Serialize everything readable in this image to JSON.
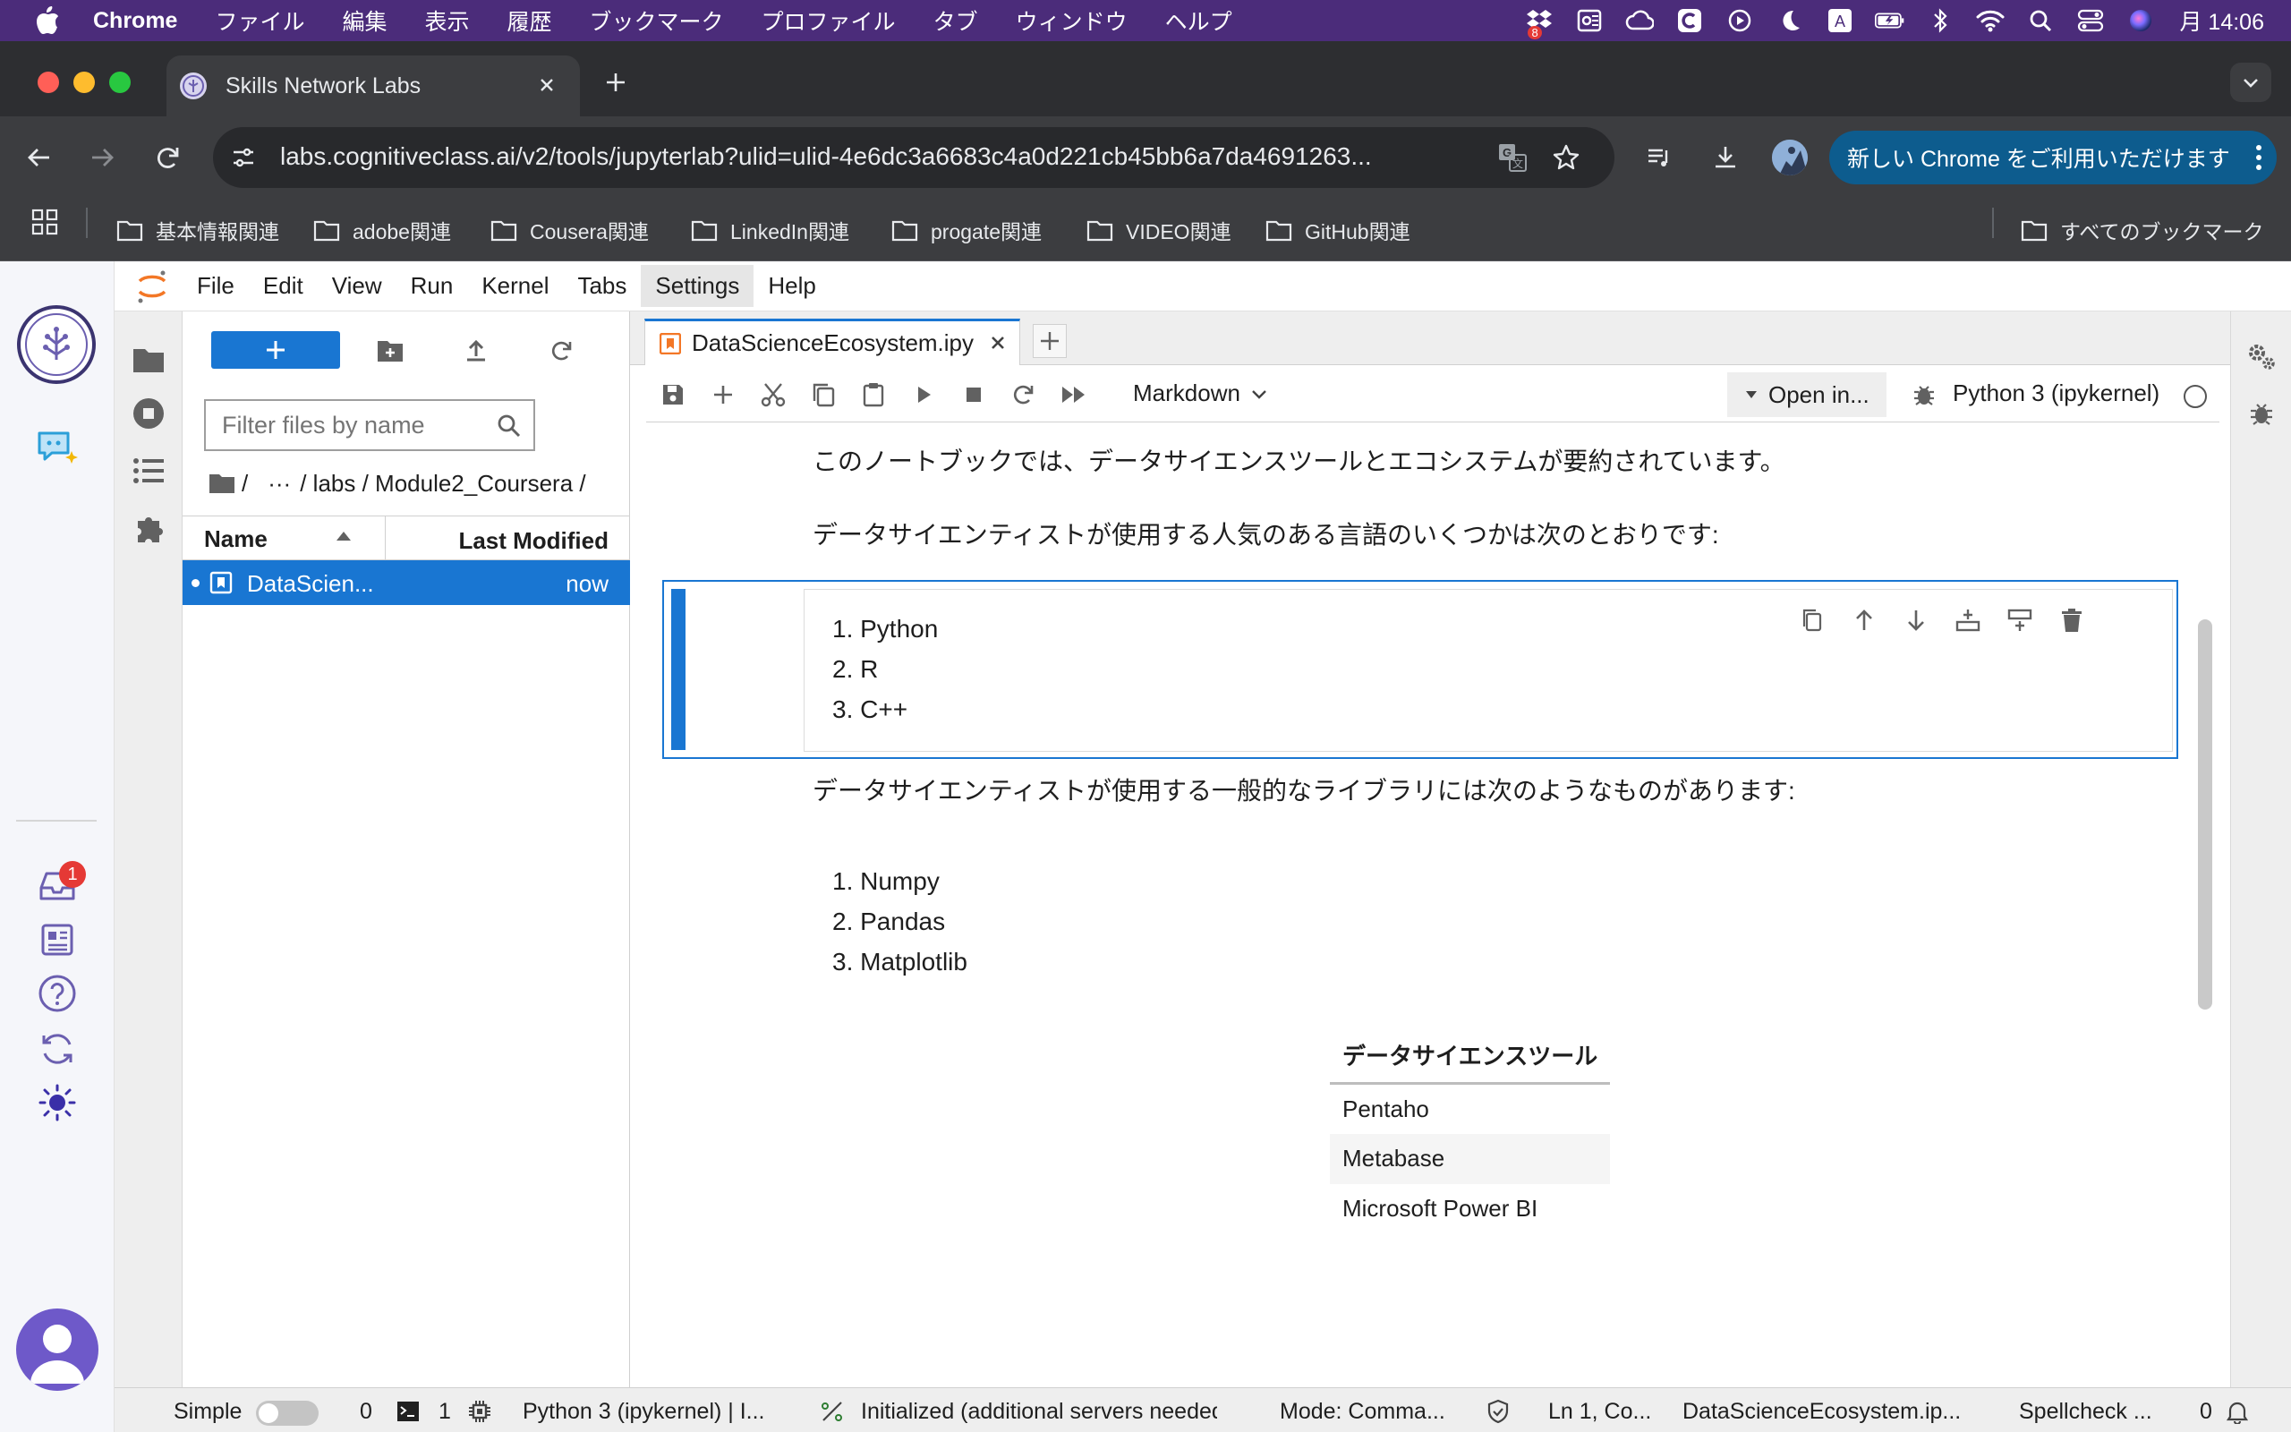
{
  "mac_menubar": {
    "app_name": "Chrome",
    "items": [
      "ファイル",
      "編集",
      "表示",
      "履歴",
      "ブックマーク",
      "プロファイル",
      "タブ",
      "ウィンドウ",
      "ヘルプ"
    ],
    "dropbox_badge": "8",
    "clock": "月 14:06"
  },
  "browser": {
    "tab_title": "Skills Network Labs",
    "url": "labs.cognitiveclass.ai/v2/tools/jupyterlab?ulid=ulid-4e6dc3a6683c4a0d221cb45bb6a7da4691263...",
    "update_button": "新しい Chrome をご利用いただけます",
    "bookmarks": [
      "基本情報関連",
      "adobe関連",
      "Cousera関連",
      "LinkedIn関連",
      "progate関連",
      "VIDEO関連",
      "GitHub関連"
    ],
    "all_bookmarks": "すべてのブックマーク"
  },
  "sn_rail": {
    "inbox_badge": "1"
  },
  "jupyter": {
    "menu": [
      "File",
      "Edit",
      "View",
      "Run",
      "Kernel",
      "Tabs",
      "Settings",
      "Help"
    ],
    "filebrowser": {
      "filter_placeholder": "Filter files by name",
      "breadcrumb": [
        "/",
        "···",
        "/ labs / Module2_Coursera /"
      ],
      "col_name": "Name",
      "col_modified": "Last Modified",
      "files": [
        {
          "name": "DataScien...",
          "modified": "now"
        }
      ]
    },
    "notebook": {
      "tab_title": "DataScienceEcosystem.ipy",
      "cell_type": "Markdown",
      "open_in": "Open in...",
      "kernel": "Python 3 (ipykernel)",
      "intro_text": "このノートブックでは、データサイエンスツールとエコシステムが要約されています。",
      "languages_heading": "データサイエンティストが使用する人気のある言語のいくつかは次のとおりです:",
      "languages": [
        "1. Python",
        "2. R",
        "3. C++"
      ],
      "libraries_heading": "データサイエンティストが使用する一般的なライブラリには次のようなものがあります:",
      "libraries": [
        "1. Numpy",
        "2. Pandas",
        "3. Matplotlib"
      ],
      "table_header": "データサイエンスツール",
      "table_rows": [
        "Pentaho",
        "Metabase",
        "Microsoft Power BI"
      ]
    },
    "statusbar": {
      "simple": "Simple",
      "terminals": "0",
      "kernels": "1",
      "kernel_status": "Python 3 (ipykernel) | I...",
      "lsp": "Initialized (additional servers needed)",
      "mode": "Mode: Comma...",
      "position": "Ln 1, Co...",
      "file": "DataScienceEcosystem.ip...",
      "spellcheck": "Spellcheck ...",
      "notifications": "0"
    }
  }
}
